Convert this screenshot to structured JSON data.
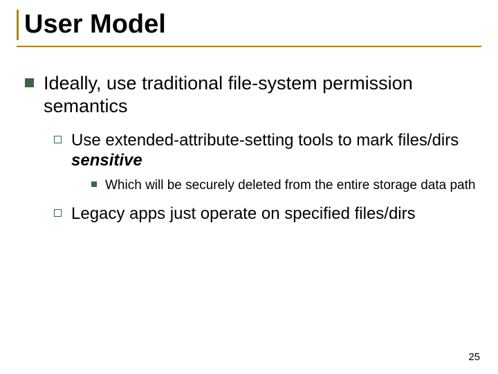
{
  "title": "User Model",
  "bullets": {
    "l1": "Ideally, use traditional file-system permission semantics",
    "l2a_prefix": "Use extended-attribute-setting tools to mark files/dirs ",
    "l2a_emph": "sensitive",
    "l3": "Which will be securely deleted from the entire storage data path",
    "l2b": "Legacy apps just operate on specified files/dirs"
  },
  "page_number": "25"
}
